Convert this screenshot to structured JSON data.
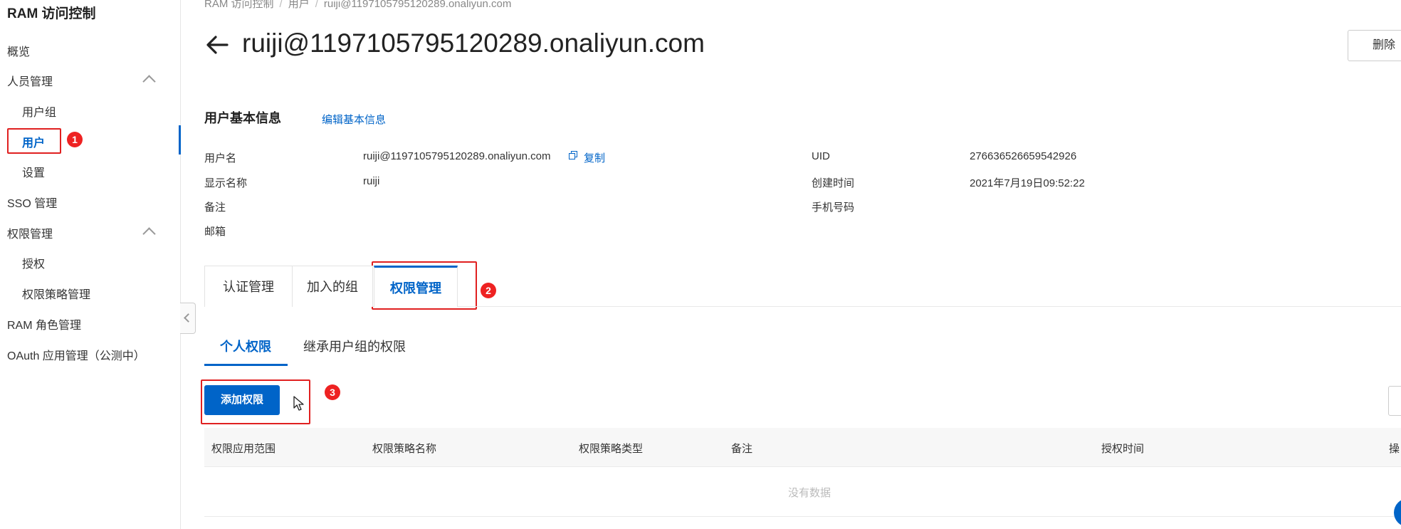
{
  "sidebar": {
    "title": "RAM 访问控制",
    "items": [
      {
        "label": "概览"
      },
      {
        "label": "人员管理"
      },
      {
        "label": "用户组"
      },
      {
        "label": "用户"
      },
      {
        "label": "设置"
      },
      {
        "label": "SSO 管理"
      },
      {
        "label": "权限管理"
      },
      {
        "label": "授权"
      },
      {
        "label": "权限策略管理"
      },
      {
        "label": "RAM 角色管理"
      },
      {
        "label": "OAuth 应用管理（公测中）"
      }
    ]
  },
  "annotations": {
    "badge1": "1",
    "badge2": "2",
    "badge3": "3"
  },
  "header": {
    "breadcrumb": [
      "RAM 访问控制",
      "用户",
      "ruiji@1197105795120289.onaliyun.com"
    ],
    "title": "ruiji@1197105795120289.onaliyun.com",
    "delete_label": "删除"
  },
  "basic_info": {
    "title": "用户基本信息",
    "edit_link": "编辑基本信息",
    "fields": {
      "username_label": "用户名",
      "username_value": "ruiji@1197105795120289.onaliyun.com",
      "copy_label": "复制",
      "display_name_label": "显示名称",
      "display_name_value": "ruiji",
      "note_label": "备注",
      "email_label": "邮箱",
      "uid_label": "UID",
      "uid_value": "276636526659542926",
      "created_label": "创建时间",
      "created_value": "2021年7月19日09:52:22",
      "phone_label": "手机号码"
    }
  },
  "tabs": [
    {
      "label": "认证管理"
    },
    {
      "label": "加入的组"
    },
    {
      "label": "权限管理"
    }
  ],
  "subtabs": [
    {
      "label": "个人权限"
    },
    {
      "label": "继承用户组的权限"
    }
  ],
  "toolbar": {
    "add_label": "添加权限"
  },
  "table": {
    "headers": [
      "权限应用范围",
      "权限策略名称",
      "权限策略类型",
      "备注",
      "授权时间",
      "操"
    ],
    "empty_text": "没有数据"
  },
  "colors": {
    "accent": "#0064c8",
    "annotation": "#e02020"
  }
}
